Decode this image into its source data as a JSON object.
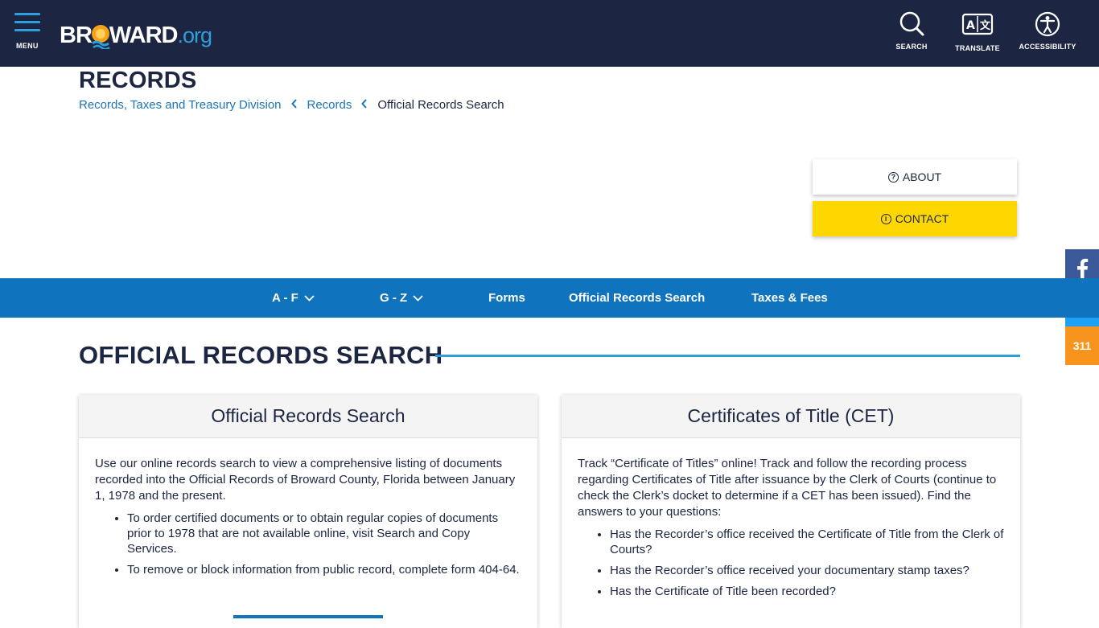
{
  "header": {
    "menu_label": "MENU",
    "logo_left": "BR",
    "logo_mid": "WARD",
    "logo_org": ".org",
    "search_label": "SEARCH",
    "translate_label": "TRANSLATE",
    "accessibility_label": "ACCESSIBILITY"
  },
  "page": {
    "title": "RECORDS",
    "breadcrumb": [
      "Records, Taxes and Treasury Division",
      "Records",
      "Official Records Search"
    ]
  },
  "side_buttons": {
    "about": "ABOUT",
    "contact": "CONTACT"
  },
  "social": {
    "b311": "311"
  },
  "nav": {
    "items": [
      "A - F",
      "G - Z",
      "Forms",
      "Official Records Search",
      "Taxes & Fees"
    ]
  },
  "section": {
    "title": "OFFICIAL RECORDS SEARCH"
  },
  "cards": [
    {
      "title": "Official Records Search",
      "intro": "Use our online records search to view a comprehensive listing of documents recorded into the Official Records of Broward County, Florida between January 1, 1978 and the present.",
      "bullets": [
        "To order certified documents or to obtain regular copies of documents prior to 1978 that are not available online, visit Search and Copy Services.",
        "To remove or block information from public record, complete form 404-64."
      ]
    },
    {
      "title": "Certificates of Title (CET)",
      "intro": "Track “Certificate of Titles” online! Track and follow the recording process regarding Certificates of Title after issuance by the Clerk of Courts (continue to check the Clerk’s docket to determine if a CET has been issued). Find the answers to your questions:",
      "bullets": [
        "Has the Recorder’s office received the Certificate of Title from the Clerk of Courts?",
        "Has the Recorder’s office received your documentary stamp taxes?",
        "Has the Certificate of Title been recorded?"
      ]
    }
  ],
  "colors": {
    "header_bg": "#1c2541",
    "accent_blue": "#2c9fdc",
    "nav_blue": "#0f74bd",
    "contact_yellow": "#ffd700"
  }
}
